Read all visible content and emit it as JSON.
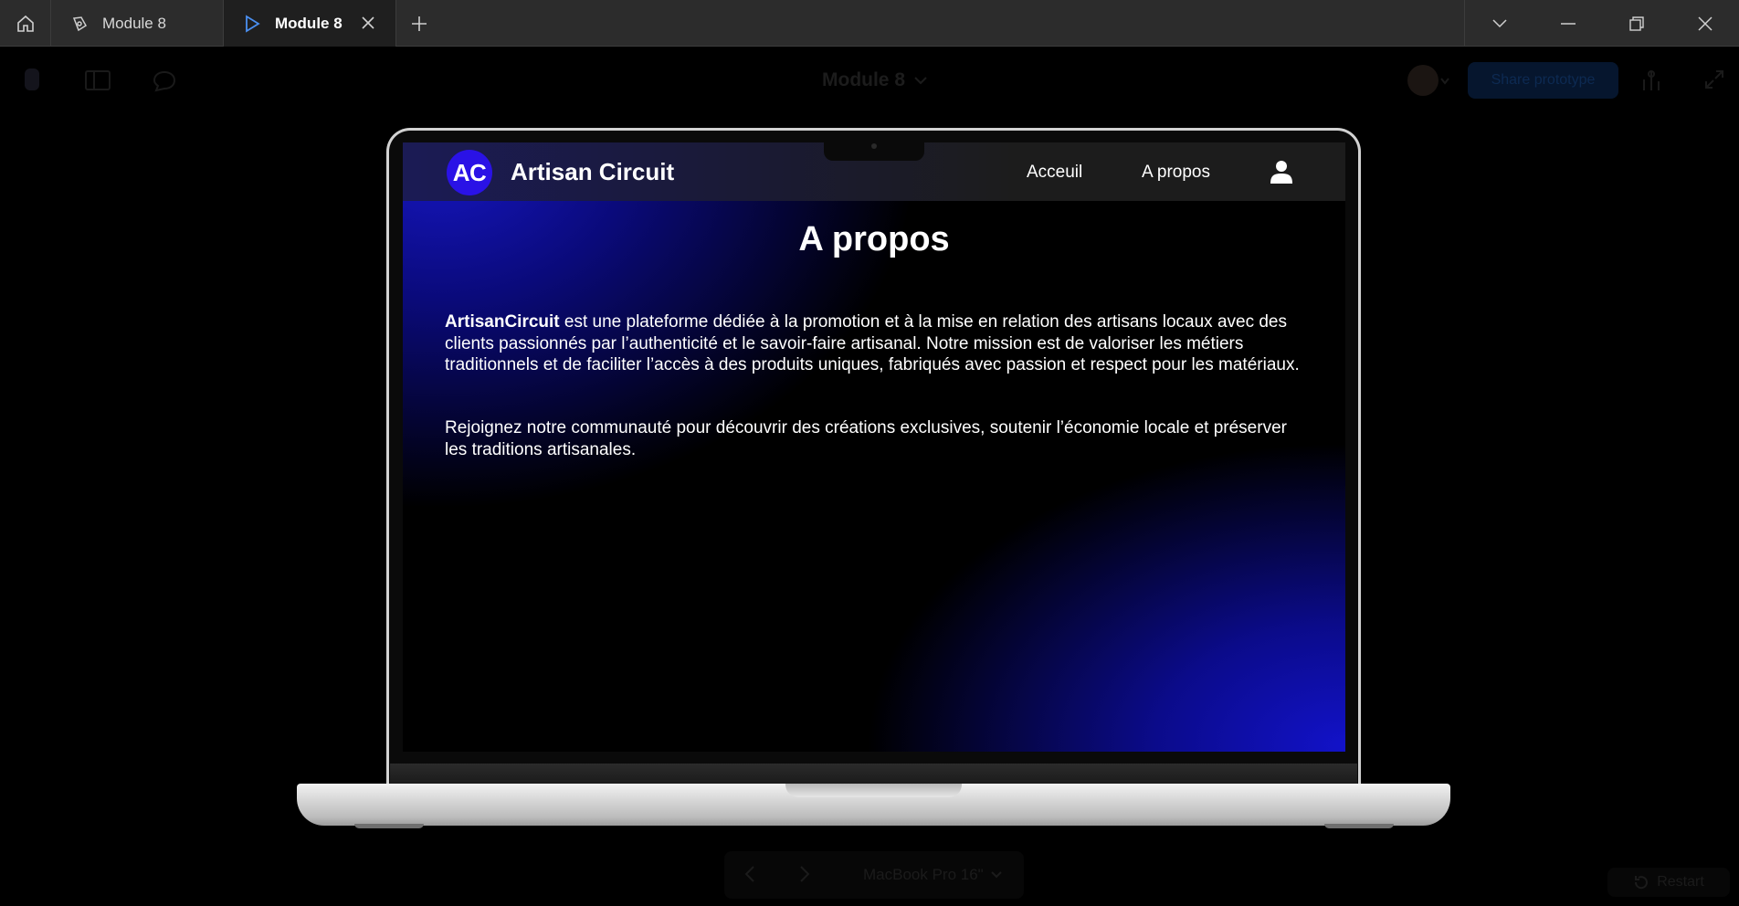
{
  "window": {
    "tabs": [
      {
        "label": "Module 8",
        "icon": "figma-file-icon",
        "active": false
      },
      {
        "label": "Module 8",
        "icon": "play-prototype-icon",
        "active": true
      }
    ]
  },
  "prototype_toolbar": {
    "file_name": "Module 8",
    "share_label": "Share prototype"
  },
  "site": {
    "logo_initials": "AC",
    "brand": "Artisan Circuit",
    "nav": [
      "Acceuil",
      "A propos"
    ],
    "page_title": "A propos",
    "para1_strong": "ArtisanCircuit",
    "para1_rest": " est une plateforme dédiée à la promotion et à la mise en relation des artisans locaux avec des clients passionnés par l’authenticité et le savoir-faire artisanal. Notre mission est de valoriser les métiers traditionnels et de faciliter l’accès à des produits uniques, fabriqués avec passion et respect pour les matériaux.",
    "para2": "Rejoignez notre communauté pour découvrir des créations exclusives, soutenir l’économie locale et préserver les traditions artisanales."
  },
  "bottom": {
    "device": "MacBook Pro 16\"",
    "restart": "Restart"
  },
  "colors": {
    "logo_bg": "#2a12e6",
    "gradient_blue": "#1212c8",
    "share_button": "#06162e"
  }
}
